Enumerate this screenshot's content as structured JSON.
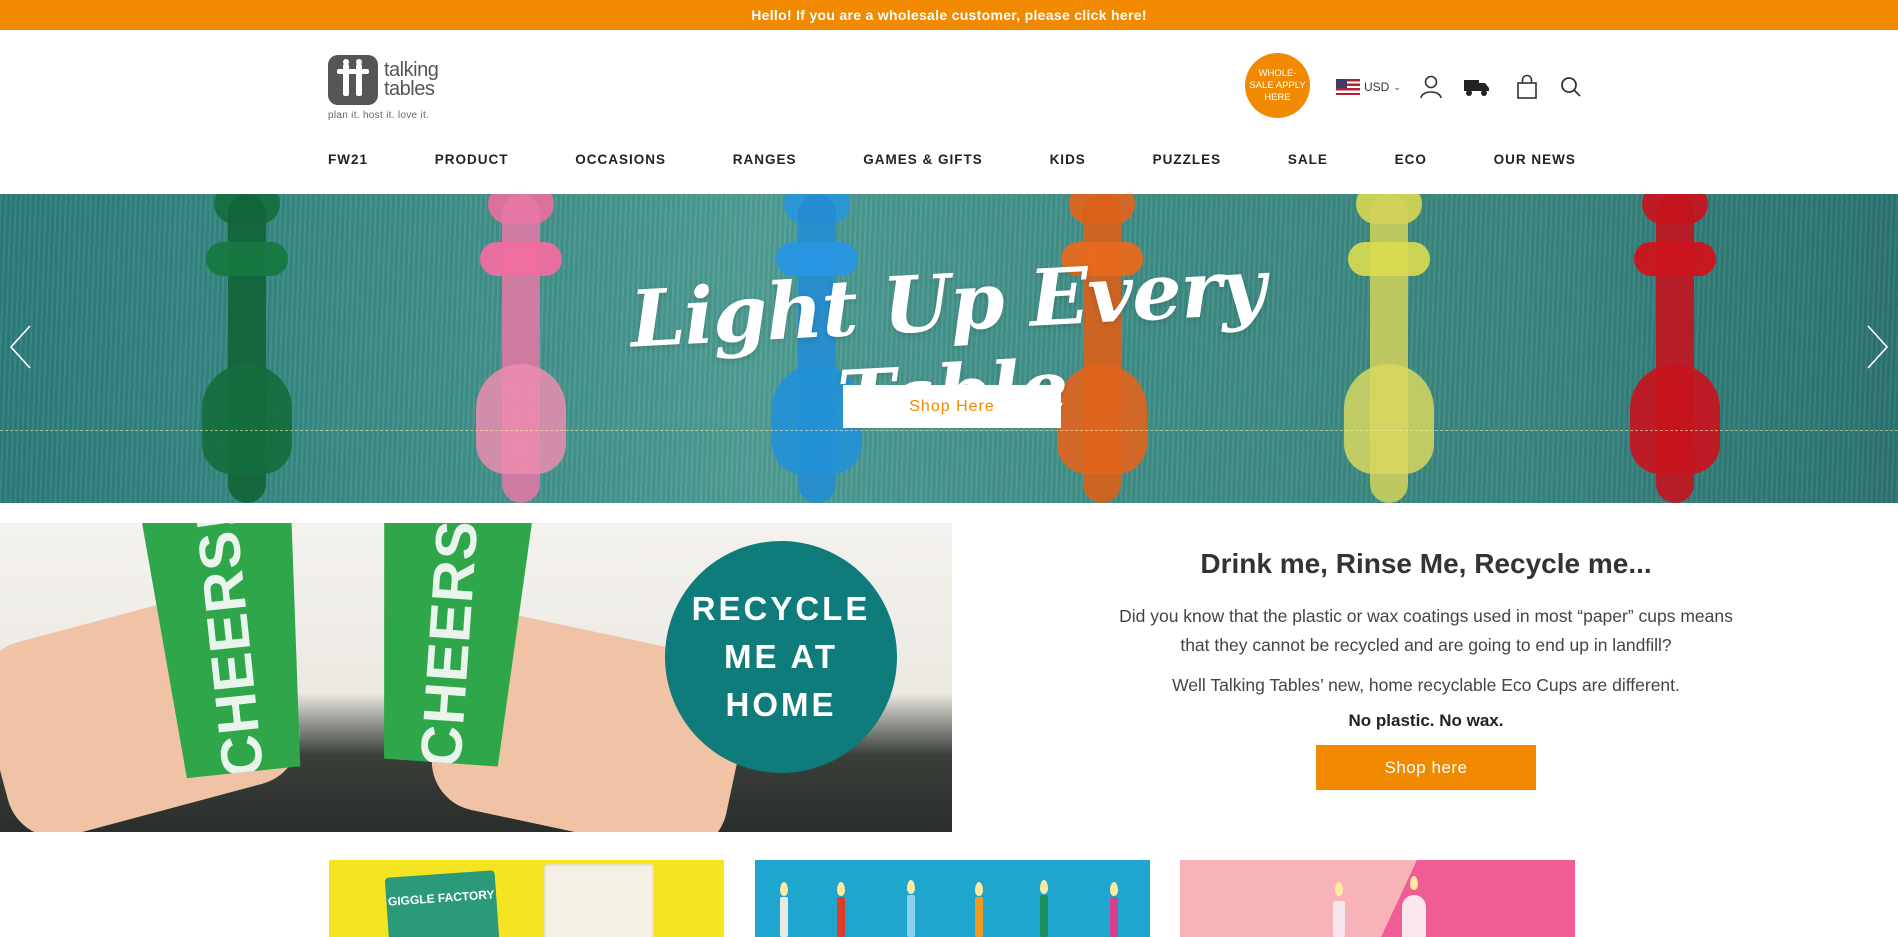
{
  "announcement": {
    "text": "Hello! If you are a wholesale customer, please click here!"
  },
  "brand": {
    "name_line1": "talking",
    "name_line2": "tables",
    "tagline": "plan it. host it. love it."
  },
  "header": {
    "wholesale_badge": "WHOLE-SALE APPLY HERE",
    "currency": "USD",
    "icons": [
      "account-icon",
      "delivery-truck-icon",
      "shopping-bag-icon",
      "search-icon"
    ]
  },
  "nav": {
    "items": [
      "FW21",
      "PRODUCT",
      "OCCASIONS",
      "RANGES",
      "GAMES & GIFTS",
      "KIDS",
      "PUZZLES",
      "SALE",
      "ECO",
      "OUR NEWS"
    ]
  },
  "hero": {
    "title": "Light Up Every Table",
    "button": "Shop Here"
  },
  "promo": {
    "image_cup_text": "CHEERS!",
    "image_circle_lines": [
      "RECYCLE",
      "ME AT",
      "HOME"
    ],
    "heading": "Drink me, Rinse Me, Recycle me...",
    "paragraph1": "Did you know that the plastic or wax coatings used in most “paper” cups means that they cannot be recycled and are going to end up in landfill?",
    "paragraph2": "Well Talking Tables’ new, home recyclable Eco Cups are different.",
    "strong": "No plastic. No wax.",
    "button": "Shop here"
  },
  "tiles": {
    "tile1_text": "GIGGLE FACTORY"
  },
  "colors": {
    "accent": "#f18a00",
    "teal": "#0f7b7a",
    "cup_green": "#2fa64a"
  }
}
